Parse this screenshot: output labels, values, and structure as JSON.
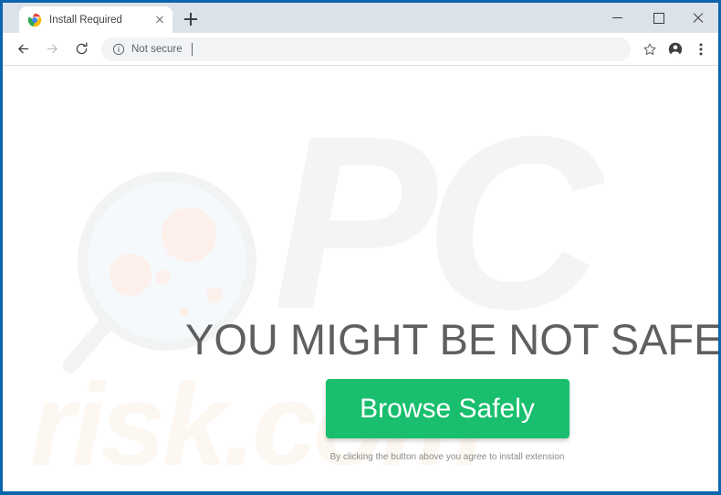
{
  "window": {
    "frame_color": "#0c65ad",
    "controls": {
      "minimize": "minimize-button",
      "maximize": "maximize-button",
      "close": "close-button"
    }
  },
  "tabstrip": {
    "tab": {
      "title": "Install Required",
      "favicon": "chrome-logo-icon",
      "close": "close-tab-icon"
    },
    "new_tab_label": "new-tab-icon"
  },
  "toolbar": {
    "back": "back-arrow-icon",
    "forward": "forward-arrow-icon",
    "reload": "reload-icon",
    "omnibox": {
      "security_icon": "info-circle-icon",
      "security_label": "Not secure",
      "url_value": "",
      "placeholder": ""
    },
    "bookmark": "star-icon",
    "profile": "profile-avatar-icon",
    "menu": "three-dot-menu-icon"
  },
  "page": {
    "headline": "YOU MIGHT BE NOT SAFE!",
    "cta_label": "Browse Safely",
    "disclaimer": "By clicking the button above you agree to install extension",
    "watermark_pc": "PC",
    "watermark_risk": "risk.com",
    "graphic": "magnifying-glass-icon",
    "colors": {
      "cta_green": "#19bf6e",
      "headline_gray": "#5f5f5f",
      "watermark_gray": "#f4f4f4",
      "watermark_cream": "#fdf7f1",
      "lens_blue": "#f3f7fc",
      "germ_pink": "#fdeee8"
    }
  }
}
